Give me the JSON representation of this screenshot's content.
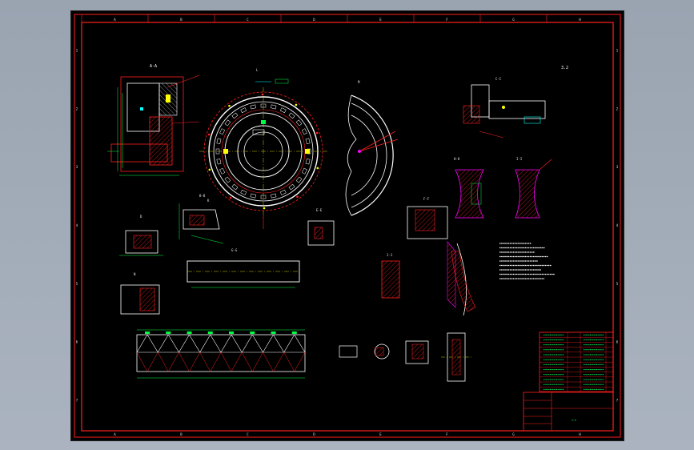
{
  "drawing": {
    "colors": {
      "background": "#000000",
      "frame": "#ff2020",
      "outline": "#ffffff",
      "dimension": "#00ff44",
      "hatch": "#ff2020",
      "center": "#ffff00",
      "accent": "#ff00ff",
      "cyan": "#00ffff"
    },
    "border_letters": [
      "A",
      "B",
      "C",
      "D",
      "E",
      "F",
      "G",
      "H"
    ],
    "border_numbers": [
      "1",
      "2",
      "3",
      "4",
      "5",
      "6",
      "7"
    ],
    "views": {
      "section_aa": "A-A",
      "section_bb": "B-B",
      "section_cc": "C-C",
      "section_ee": "E-E",
      "section_ff": "F-F",
      "section_gg": "G-G",
      "section_hh": "H-H",
      "section_ii": "I-I",
      "section_jj": "J-J",
      "view_d": "D",
      "view_k": "K",
      "view_l": "L",
      "view_m": "M",
      "view_n": "N"
    },
    "roughness": "3.2",
    "sheet_scale": "1:5"
  }
}
